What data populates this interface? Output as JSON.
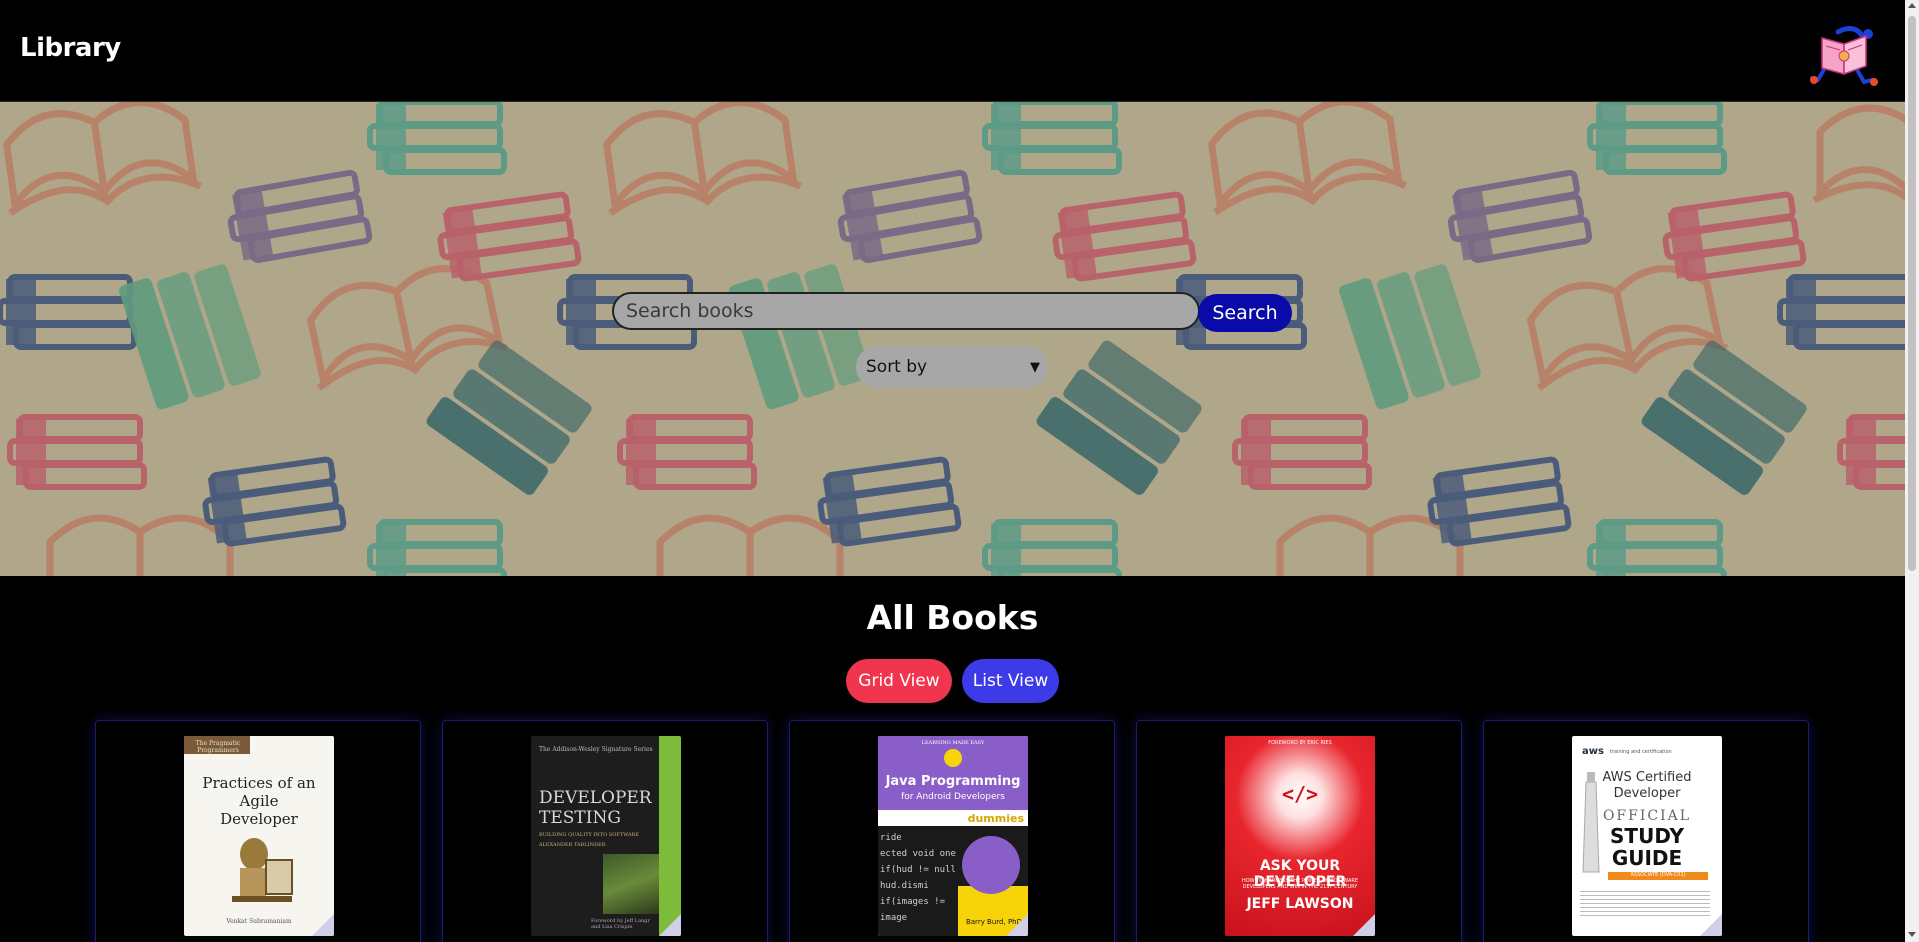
{
  "header": {
    "brand": "Library",
    "avatar_icon": "reading-mascot-icon"
  },
  "hero": {
    "search_placeholder": "Search books",
    "search_value": "",
    "search_button": "Search",
    "sort_selected": "Sort by",
    "background_icon": "books-pattern-icon"
  },
  "main": {
    "title": "All Books",
    "grid_view_label": "Grid View",
    "list_view_label": "List View"
  },
  "books": [
    {
      "cover_lines": [
        "Practices of an",
        "Agile",
        "Developer"
      ],
      "byline": "Venkat Subramaniam",
      "badge": "The Pragmatic Programmers"
    },
    {
      "cover_lines": [
        "DEVELOPER",
        "TESTING"
      ],
      "subtitle": "BUILDING QUALITY INTO SOFTWARE",
      "byline": "ALEXANDER TARLINDER",
      "series": "The Addison-Wesley Signature Series",
      "foreword": "Foreword by Jeff Langr and Lisa Crispin"
    },
    {
      "cover_lines": [
        "Java Programming",
        "for Android Developers"
      ],
      "brand": "dummies",
      "edition": "2nd Edition",
      "series": "LEARNING MADE EASY",
      "byline": "Barry Burd, PhD",
      "code_lines": [
        "ride",
        "ected void one",
        "if(hud != null",
        "hud.dismi",
        "if(images !=",
        "image"
      ]
    },
    {
      "cover_lines": [
        "ASK YOUR DEVELOPER"
      ],
      "subtitle": "HOW TO HARNESS THE POWER OF SOFTWARE DEVELOPERS AND WIN IN THE 21ST CENTURY",
      "byline": "JEFF LAWSON",
      "tagline": "FOREWORD BY ERIC RIES",
      "symbol": "</>"
    },
    {
      "cover_lines": [
        "AWS Certified",
        "Developer"
      ],
      "brand": "aws",
      "brand_sub": "training and certification",
      "official": "OFFICIAL",
      "study_guide": [
        "STUDY",
        "GUIDE"
      ],
      "exam_band": "ASSOCIATE (DVA-C01)"
    }
  ],
  "colors": {
    "header_bg": "#000000",
    "hero_bg": "#b0a78a",
    "search_button": "#0a0aa8",
    "grid_view": "#f0354f",
    "list_view": "#3d3ae8",
    "card_border": "#1c1c6e"
  }
}
